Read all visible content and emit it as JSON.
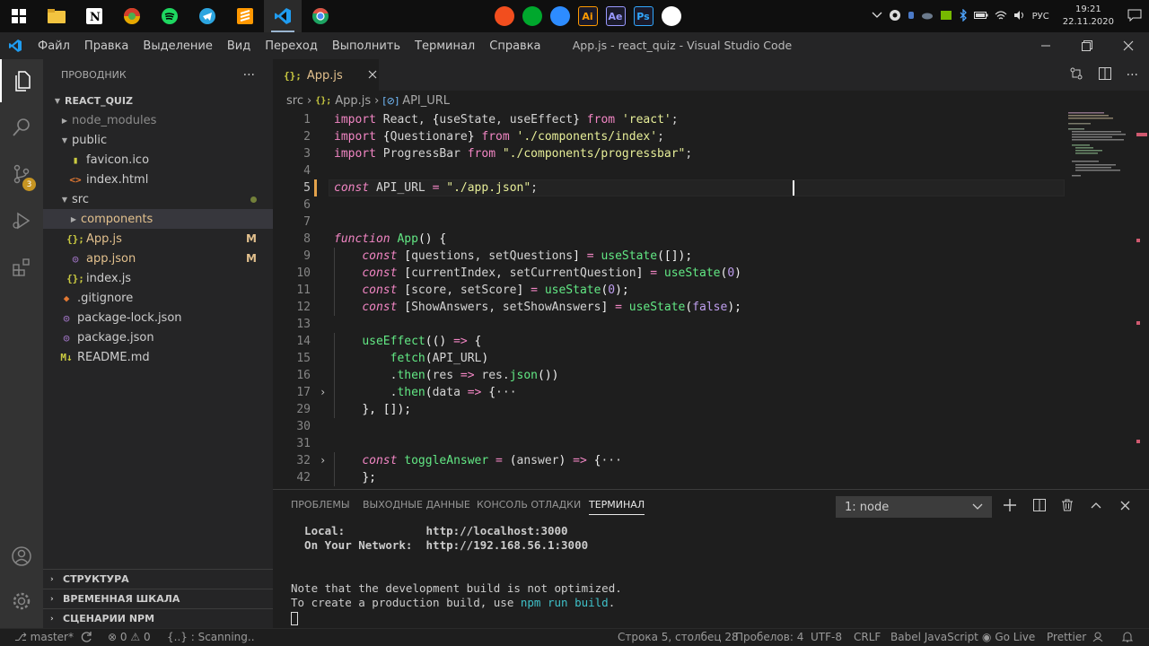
{
  "taskbar": {
    "clock_time": "19:21",
    "clock_date": "22.11.2020",
    "lang": "РУС",
    "center_apps": [
      {
        "icon": "figma-icon",
        "color": "#f24e1e",
        "label": ""
      },
      {
        "icon": "evernote-like-icon",
        "color": "#00a82d",
        "label": ""
      },
      {
        "icon": "timer-icon",
        "color": "#2d8cff",
        "label": ""
      },
      {
        "icon": "illustrator-icon",
        "color": "#ff9a00",
        "label": "Ai"
      },
      {
        "icon": "after-effects-icon",
        "color": "#9999ff",
        "label": "Ae"
      },
      {
        "icon": "photoshop-icon",
        "color": "#31a8ff",
        "label": "Ps"
      },
      {
        "icon": "obs-icon",
        "color": "#ffffff",
        "label": ""
      }
    ]
  },
  "titlebar": {
    "menu": [
      "Файл",
      "Правка",
      "Выделение",
      "Вид",
      "Переход",
      "Выполнить",
      "Терминал",
      "Справка"
    ],
    "title": "App.js - react_quiz - Visual Studio Code"
  },
  "activity": {
    "scm_badge": "3"
  },
  "sidebar": {
    "title": "ПРОВОДНИК",
    "more": "···",
    "root": "REACT_QUIZ",
    "items": [
      {
        "label": "node_modules",
        "type": "folder",
        "depth": 1,
        "color": "#8b8b8b"
      },
      {
        "label": "public",
        "type": "folder-open",
        "depth": 1,
        "color": "#cccccc"
      },
      {
        "label": "favicon.ico",
        "type": "file",
        "depth": 2,
        "color": "#cccccc",
        "icon_glyph": "▮",
        "icon_color": "#cbcb41"
      },
      {
        "label": "index.html",
        "type": "file",
        "depth": 2,
        "color": "#cccccc",
        "icon_glyph": "<>",
        "icon_color": "#e37933"
      },
      {
        "label": "src",
        "type": "folder-open",
        "depth": 1,
        "color": "#cccccc",
        "status": "dot"
      },
      {
        "label": "components",
        "type": "folder",
        "depth": 2,
        "color": "#e2c08d",
        "selected": true
      },
      {
        "label": "App.js",
        "type": "file",
        "depth": 2,
        "color": "#e2c08d",
        "icon_glyph": "{};",
        "icon_color": "#cbcb41",
        "badge": "M"
      },
      {
        "label": "app.json",
        "type": "file",
        "depth": 2,
        "color": "#e2c08d",
        "icon_glyph": "◎",
        "icon_color": "#a074c4",
        "badge": "M"
      },
      {
        "label": "index.js",
        "type": "file",
        "depth": 2,
        "color": "#cccccc",
        "icon_glyph": "{};",
        "icon_color": "#cbcb41"
      },
      {
        "label": ".gitignore",
        "type": "file",
        "depth": 1,
        "color": "#cccccc",
        "icon_glyph": "◆",
        "icon_color": "#e37933"
      },
      {
        "label": "package-lock.json",
        "type": "file",
        "depth": 1,
        "color": "#cccccc",
        "icon_glyph": "◎",
        "icon_color": "#a074c4"
      },
      {
        "label": "package.json",
        "type": "file",
        "depth": 1,
        "color": "#cccccc",
        "icon_glyph": "◎",
        "icon_color": "#a074c4"
      },
      {
        "label": "README.md",
        "type": "file",
        "depth": 1,
        "color": "#cccccc",
        "icon_glyph": "M↓",
        "icon_color": "#cbcb41"
      }
    ],
    "sections": [
      "СТРУКТУРА",
      "ВРЕМЕННАЯ ШКАЛА",
      "СЦЕНАРИИ NPM"
    ]
  },
  "editor": {
    "tab_label": "App.js",
    "breadcrumb": [
      "src",
      "App.js",
      "API_URL"
    ],
    "current_line": "5",
    "lines": [
      {
        "n": "1",
        "fold": "",
        "tokens": [
          [
            "kw2",
            "import "
          ],
          [
            "var",
            "React, "
          ],
          [
            "pn",
            "{"
          ],
          [
            "var",
            "useState, useEffect"
          ],
          [
            "pn",
            "}"
          ],
          [
            "kw2",
            " from "
          ],
          [
            "str",
            "'react'"
          ],
          [
            "var",
            ";"
          ]
        ]
      },
      {
        "n": "2",
        "fold": "",
        "tokens": [
          [
            "kw2",
            "import "
          ],
          [
            "pn",
            "{"
          ],
          [
            "var",
            "Questionare"
          ],
          [
            "pn",
            "}"
          ],
          [
            "kw2",
            " from "
          ],
          [
            "str",
            "'./components/index'"
          ],
          [
            "var",
            ";"
          ]
        ]
      },
      {
        "n": "3",
        "fold": "",
        "tokens": [
          [
            "kw2",
            "import "
          ],
          [
            "var",
            "ProgressBar"
          ],
          [
            "kw2",
            " from "
          ],
          [
            "str",
            "\"./components/progressbar\""
          ],
          [
            "var",
            ";"
          ]
        ]
      },
      {
        "n": "4",
        "fold": "",
        "tokens": []
      },
      {
        "n": "5",
        "fold": "",
        "tokens": [
          [
            "kw",
            "const "
          ],
          [
            "var",
            "API_URL "
          ],
          [
            "kw2",
            "= "
          ],
          [
            "str",
            "\"./app.json\""
          ],
          [
            "var",
            ";"
          ]
        ]
      },
      {
        "n": "6",
        "fold": "",
        "tokens": []
      },
      {
        "n": "7",
        "fold": "",
        "tokens": []
      },
      {
        "n": "8",
        "fold": "",
        "tokens": [
          [
            "kw",
            "function "
          ],
          [
            "fn",
            "App"
          ],
          [
            "pn",
            "() {"
          ]
        ]
      },
      {
        "n": "9",
        "fold": "",
        "tokens": [
          [
            "var",
            "    "
          ],
          [
            "kw",
            "const "
          ],
          [
            "pn",
            "["
          ],
          [
            "var",
            "questions, setQuestions"
          ],
          [
            "pn",
            "]"
          ],
          [
            "kw2",
            " = "
          ],
          [
            "fn",
            "useState"
          ],
          [
            "pn",
            "([]);"
          ]
        ]
      },
      {
        "n": "10",
        "fold": "",
        "tokens": [
          [
            "var",
            "    "
          ],
          [
            "kw",
            "const "
          ],
          [
            "pn",
            "["
          ],
          [
            "var",
            "currentIndex, setCurrentQuestion"
          ],
          [
            "pn",
            "]"
          ],
          [
            "kw2",
            " = "
          ],
          [
            "fn",
            "useState"
          ],
          [
            "pn",
            "("
          ],
          [
            "num",
            "0"
          ],
          [
            "pn",
            ")"
          ]
        ]
      },
      {
        "n": "11",
        "fold": "",
        "tokens": [
          [
            "var",
            "    "
          ],
          [
            "kw",
            "const "
          ],
          [
            "pn",
            "["
          ],
          [
            "var",
            "score, setScore"
          ],
          [
            "pn",
            "]"
          ],
          [
            "kw2",
            " = "
          ],
          [
            "fn",
            "useState"
          ],
          [
            "pn",
            "("
          ],
          [
            "num",
            "0"
          ],
          [
            "pn",
            ");"
          ]
        ]
      },
      {
        "n": "12",
        "fold": "",
        "tokens": [
          [
            "var",
            "    "
          ],
          [
            "kw",
            "const "
          ],
          [
            "pn",
            "["
          ],
          [
            "var",
            "ShowAnswers, setShowAnswers"
          ],
          [
            "pn",
            "]"
          ],
          [
            "kw2",
            " = "
          ],
          [
            "fn",
            "useState"
          ],
          [
            "pn",
            "("
          ],
          [
            "num",
            "false"
          ],
          [
            "pn",
            ");"
          ]
        ]
      },
      {
        "n": "13",
        "fold": "",
        "tokens": []
      },
      {
        "n": "14",
        "fold": "",
        "tokens": [
          [
            "var",
            "    "
          ],
          [
            "fn",
            "useEffect"
          ],
          [
            "pn",
            "(() "
          ],
          [
            "kw2",
            "=>"
          ],
          [
            "pn",
            " {"
          ]
        ]
      },
      {
        "n": "15",
        "fold": "",
        "tokens": [
          [
            "var",
            "        "
          ],
          [
            "fn",
            "fetch"
          ],
          [
            "pn",
            "("
          ],
          [
            "var",
            "API_URL"
          ],
          [
            "pn",
            ")"
          ]
        ]
      },
      {
        "n": "16",
        "fold": "",
        "tokens": [
          [
            "var",
            "        ."
          ],
          [
            "fn",
            "then"
          ],
          [
            "pn",
            "("
          ],
          [
            "var",
            "res "
          ],
          [
            "kw2",
            "=>"
          ],
          [
            "var",
            " res."
          ],
          [
            "fn",
            "json"
          ],
          [
            "pn",
            "())"
          ]
        ]
      },
      {
        "n": "17",
        "fold": "›",
        "tokens": [
          [
            "var",
            "        ."
          ],
          [
            "fn",
            "then"
          ],
          [
            "pn",
            "("
          ],
          [
            "var",
            "data "
          ],
          [
            "kw2",
            "=>"
          ],
          [
            "pn",
            " {"
          ],
          [
            "var",
            "···"
          ]
        ]
      },
      {
        "n": "29",
        "fold": "",
        "tokens": [
          [
            "var",
            "    "
          ],
          [
            "pn",
            "}, []);"
          ]
        ]
      },
      {
        "n": "30",
        "fold": "",
        "tokens": []
      },
      {
        "n": "31",
        "fold": "",
        "tokens": []
      },
      {
        "n": "32",
        "fold": "›",
        "tokens": [
          [
            "var",
            "    "
          ],
          [
            "kw",
            "const "
          ],
          [
            "fn",
            "toggleAnswer"
          ],
          [
            "kw2",
            " = "
          ],
          [
            "pn",
            "("
          ],
          [
            "var",
            "answer"
          ],
          [
            "pn",
            ") "
          ],
          [
            "kw2",
            "=>"
          ],
          [
            "pn",
            " {"
          ],
          [
            "var",
            "···"
          ]
        ]
      },
      {
        "n": "42",
        "fold": "",
        "tokens": [
          [
            "var",
            "    "
          ],
          [
            "pn",
            "};"
          ]
        ]
      }
    ]
  },
  "panel": {
    "tabs": [
      "ПРОБЛЕМЫ",
      "ВЫХОДНЫЕ ДАННЫЕ",
      "КОНСОЛЬ ОТЛАДКИ",
      "ТЕРМИНАЛ"
    ],
    "active_tab": "ТЕРМИНАЛ",
    "terminal_select": "1: node",
    "output": [
      "  Local:            http://localhost:3000",
      "  On Your Network:  http://192.168.56.1:3000",
      "",
      "Note that the development build is not optimized.",
      "To create a production build, use npm run build."
    ]
  },
  "status": {
    "branch": "master*",
    "errors": "0",
    "warnings": "0",
    "scanning": "{..} : Scanning..",
    "position": "Строка 5, столбец 28",
    "spaces": "Пробелов: 4",
    "encoding": "UTF-8",
    "eol": "CRLF",
    "language": "Babel JavaScript",
    "golive": "Go Live",
    "prettier": "Prettier"
  }
}
